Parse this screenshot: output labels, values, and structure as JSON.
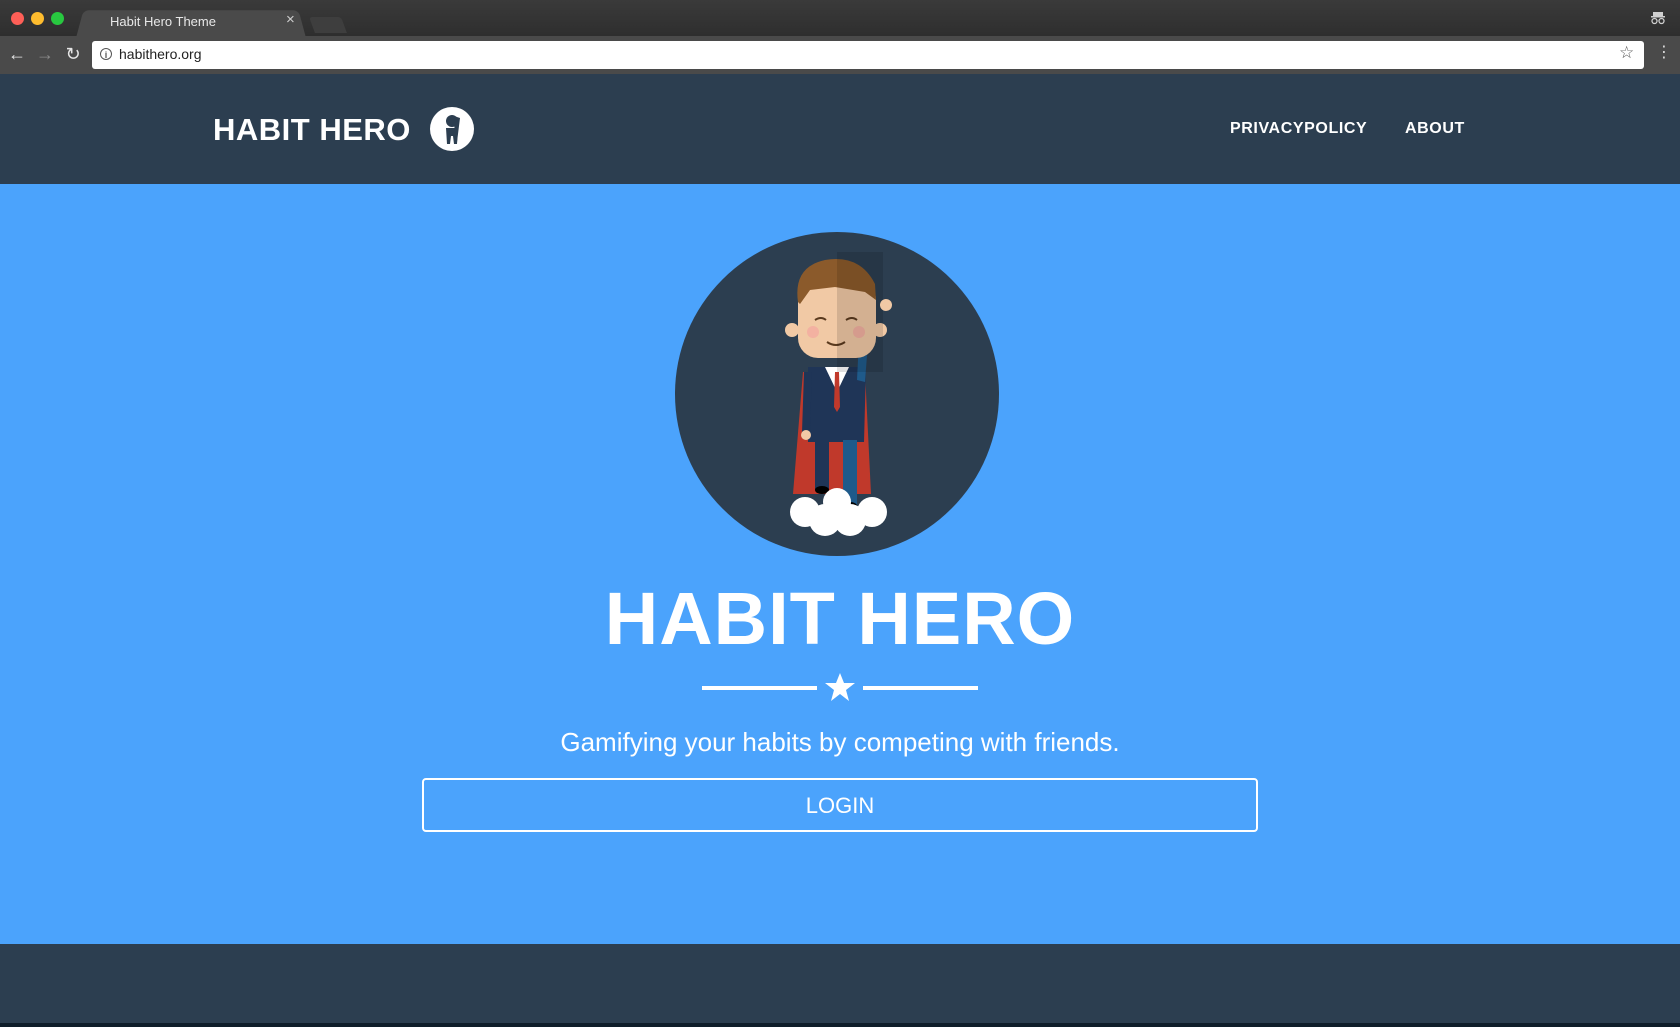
{
  "browser": {
    "tab_title": "Habit Hero Theme",
    "tab_close": "×",
    "url": "habithero.org",
    "info_glyph": "i",
    "star_glyph": "☆",
    "menu_glyph": "⋮",
    "back_glyph": "←",
    "forward_glyph": "→",
    "reload_glyph": "↻"
  },
  "navbar": {
    "brand": "HABIT HERO",
    "links": [
      {
        "label": "PRIVACYPOLICY"
      },
      {
        "label": "ABOUT"
      }
    ]
  },
  "hero": {
    "title": "HABIT HERO",
    "tagline": "Gamifying your habits by competing with friends.",
    "login_label": "LOGIN"
  },
  "colors": {
    "navbar_bg": "#2c3e50",
    "hero_bg": "#4ba3fc",
    "text": "#ffffff"
  },
  "icons": [
    "incognito-icon",
    "info-icon",
    "star-icon",
    "hero-logo-icon",
    "star-divider-icon"
  ]
}
